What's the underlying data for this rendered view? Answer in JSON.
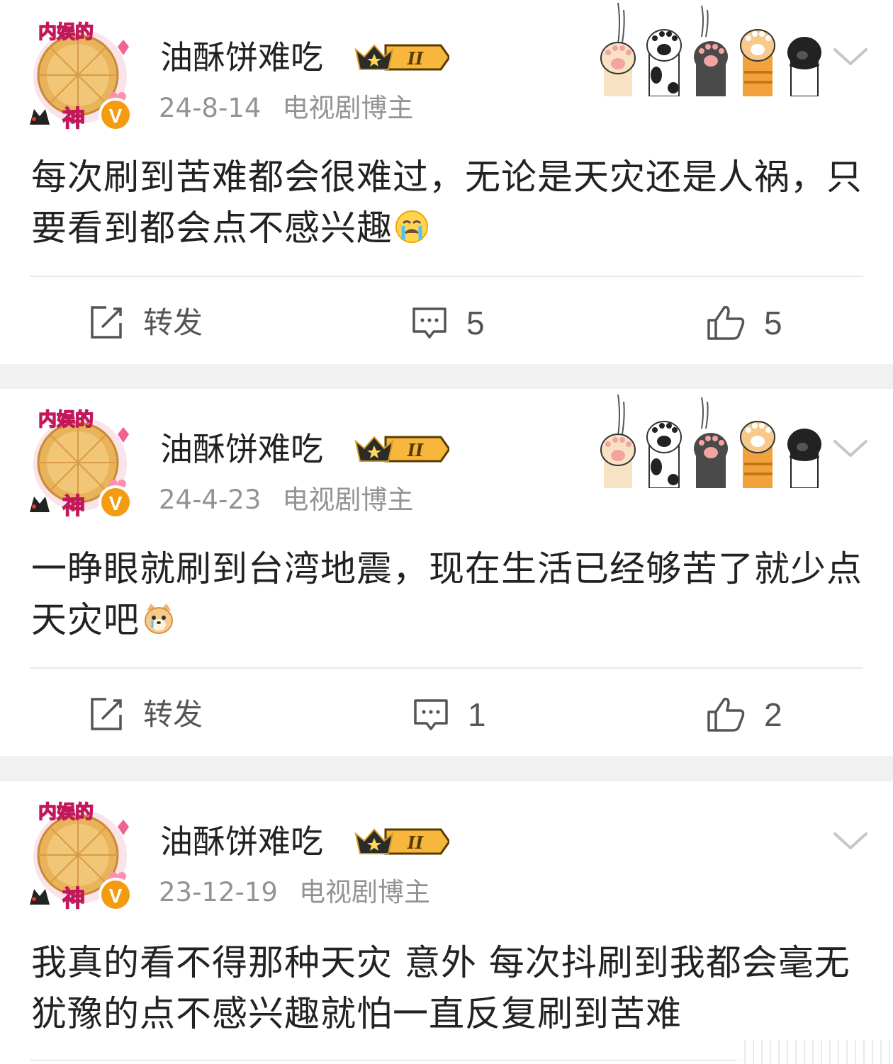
{
  "posts": [
    {
      "author": "油酥饼难吃",
      "avatar_caption_top": "内娱的",
      "avatar_caption_bottom": "神",
      "verified_mark": "V",
      "badge_level": "II",
      "date": "24-8-14",
      "source": "电视剧博主",
      "content": "每次刷到苦难都会很难过，无论是天灾还是人祸，只要看到都会点不感兴趣",
      "content_emoji": "crying-face-emoji",
      "actions": {
        "repost_label": "转发",
        "comment_count": "5",
        "like_count": "5"
      }
    },
    {
      "author": "油酥饼难吃",
      "avatar_caption_top": "内娱的",
      "avatar_caption_bottom": "神",
      "verified_mark": "V",
      "badge_level": "II",
      "date": "24-4-23",
      "source": "电视剧博主",
      "content": "一睁眼就刷到台湾地震，现在生活已经够苦了就少点天灾吧",
      "content_emoji": "crying-dog-emoji",
      "actions": {
        "repost_label": "转发",
        "comment_count": "1",
        "like_count": "2"
      }
    },
    {
      "author": "油酥饼难吃",
      "avatar_caption_top": "内娱的",
      "avatar_caption_bottom": "神",
      "verified_mark": "V",
      "badge_level": "II",
      "date": "23-12-19",
      "source": "电视剧博主",
      "content": "我真的看不得那种天灾 意外 每次抖刷到我都会毫无犹豫的点不感兴趣就怕一直反复刷到苦难"
    }
  ],
  "colors": {
    "page_background": "#f1f1f1",
    "card_background": "#ffffff",
    "text_primary": "#222222",
    "text_meta": "#939393",
    "verified_orange": "#f39c12",
    "badge_gold": "#f6b73c"
  }
}
